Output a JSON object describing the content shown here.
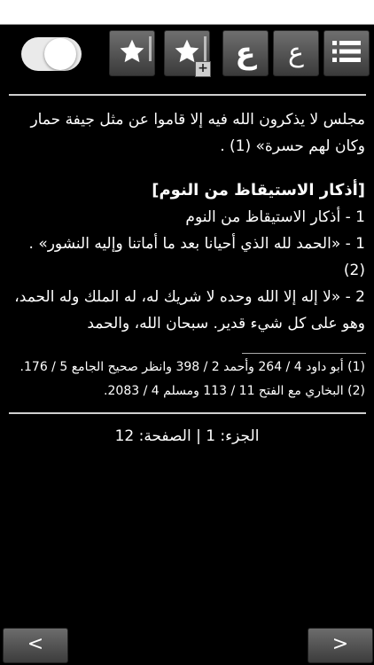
{
  "toolbar": {
    "toggle_on": true,
    "icons": [
      "star-icon",
      "star-add-icon",
      "ain-bold-icon",
      "ain-light-icon",
      "menu-icon"
    ],
    "ain_bold": "ع",
    "ain_light": "ع",
    "plus": "+"
  },
  "content": {
    "p1": "مجلس لا يذكرون الله فيه إلا قاموا عن مثل جيفة حمار وكان لهم حسرة» (1) .",
    "heading": "[أذكار الاستيقاظ من النوم]",
    "line1": "1 - أذكار الاستيقاظ من النوم",
    "line2": "1 - «الحمد لله الذي أحيانا بعد ما أماتنا وإليه النشور» . (2)",
    "line3": "2 - «لا إله إلا الله وحده لا شريك له، له الملك وله الحمد، وهو على كل شيء قدير. سبحان الله، والحمد",
    "footnotes": [
      "(1) أبو داود 4 / 264 وأحمد 2 / 398 وانظر صحيح الجامع 5 / 176.",
      "(2) البخاري مع الفتح 11 / 113 ومسلم 4 / 2083."
    ]
  },
  "page_info": "الجزء: 1 | الصفحة: 12",
  "nav": {
    "prev_label": "<",
    "next_label": ">"
  }
}
